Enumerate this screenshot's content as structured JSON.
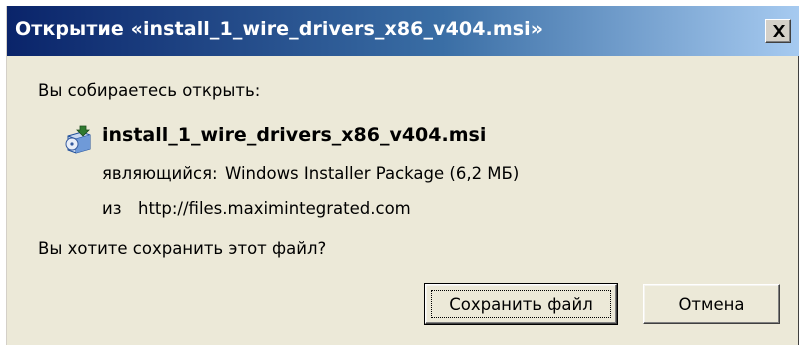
{
  "window": {
    "title": "Открытие «install_1_wire_drivers_x86_v404.msi»",
    "close_symbol": "×"
  },
  "prompt": "Вы собираетесь открыть:",
  "file": {
    "name": "install_1_wire_drivers_x86_v404.msi",
    "icon": "msi-installer-icon",
    "type_label": "являющийся:",
    "type_value": "Windows Installer Package (6,2 МБ)",
    "from_label": "из",
    "from_value": "http://files.maximintegrated.com"
  },
  "question": "Вы хотите сохранить этот файл?",
  "buttons": {
    "save": "Сохранить файл",
    "cancel": "Отмена"
  },
  "colors": {
    "title_gradient_start": "#0a246a",
    "title_gradient_end": "#a6caf0",
    "dialog_background": "#ece9d8"
  }
}
